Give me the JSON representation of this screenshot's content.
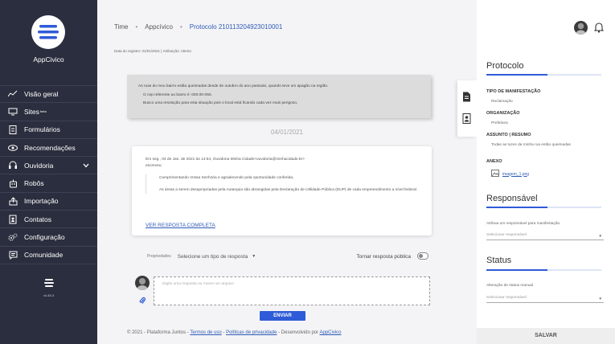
{
  "app": {
    "name": "AppCivico",
    "version": "v4.45.3"
  },
  "sidebar": {
    "items": [
      {
        "label": "Visão geral",
        "icon": "chart-line-icon"
      },
      {
        "label": "Sites",
        "beta": "beta",
        "icon": "monitor-icon"
      },
      {
        "label": "Formulários",
        "icon": "clipboard-icon"
      },
      {
        "label": "Recomendações",
        "icon": "eye-icon"
      },
      {
        "label": "Ouvidoria",
        "icon": "headset-icon",
        "expandable": true
      },
      {
        "label": "Robôs",
        "icon": "robot-icon"
      },
      {
        "label": "Importação",
        "icon": "upload-icon"
      },
      {
        "label": "Contatos",
        "icon": "address-book-icon"
      },
      {
        "label": "Configuração",
        "icon": "gears-icon"
      },
      {
        "label": "Comunidade",
        "icon": "chat-icon"
      }
    ]
  },
  "breadcrumb": {
    "team": "Time",
    "app": "Appcívico",
    "protocol": "Protocolo 210113204923010001"
  },
  "meta": {
    "registro": "Data do registro: 01/01/2021 | Atribuição: Aberto"
  },
  "message": {
    "lines": [
      "As ruas do meu bairro estão queimadas desde de outubro do ano passado, quando teve um apagão na região.",
      "O cep referente ao bairro é: 000.00-050.",
      "Busco uma resolução para esta situação pois o local está ficando cada vez mais perigoso."
    ]
  },
  "thread": {
    "date": "04/01/2021",
    "header": "Em seg., 04 de Jan. de 2021 às 14:54, Ouvidoria Minha Cidade<ouvidoria@minhacidade.br>",
    "header2": "escreveu:",
    "quote": [
      "Cumprimentando Vossa Senhoria e agradecendo pela oportunidade conferida,",
      "As áreas a serem desapropriadas pela Autarquia são abrangidas pela Declaração de Utilidade Pública (DUP) de cada empreendimento a nível federal."
    ],
    "link": "VER RESPOSTA COMPLETA"
  },
  "reply": {
    "props_label": "Propriedades",
    "type_placeholder": "Selecione um tipo de resposta",
    "public_label": "Tornar resposta pública",
    "public_enabled": false,
    "placeholder": "Digite uma resposta ou Anexe um arquivo",
    "send": "ENVIAR"
  },
  "footer": {
    "copyright": "© 2021 - Plataforma Juntos -",
    "terms": "Termos de uso",
    "dash": "-",
    "privacy": "Políticas de privacidade",
    "dev": "- Desenvolvido por",
    "dev_link": "AppCivico"
  },
  "panel": {
    "protocol_title": "Protocolo",
    "tipo_label": "TIPO DE MANIFESTAÇÃO",
    "tipo_value": "Reclamação",
    "org_label": "ORGANIZAÇÃO",
    "org_value": "Prefeitura",
    "assunto_label": "ASSUNTO | RESUMO",
    "assunto_value": "Todas as luzes da minha rua estão queimadas",
    "anexo_label": "ANEXO",
    "anexo_file": "imagem_1.png",
    "resp_title": "Responsável",
    "resp_label": "Atribua um responsável para manifestação",
    "resp_placeholder": "Selecionar responsável",
    "status_title": "Status",
    "status_label": "Alteração de status manual",
    "status_placeholder": "Selecionar responsável",
    "save": "SALVAR"
  },
  "colors": {
    "sidebar_bg": "#2b2e3e",
    "accent": "#2f5bd8",
    "link": "#2f5bb7"
  }
}
